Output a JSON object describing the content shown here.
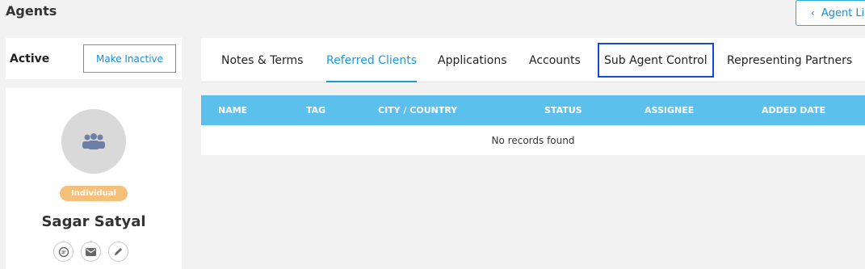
{
  "header": {
    "title": "Agents",
    "agent_list_label": "Agent List"
  },
  "status": {
    "label": "Active",
    "toggle_label": "Make Inactive"
  },
  "profile": {
    "type_badge": "Individual",
    "name": "Sagar Satyal",
    "actions": [
      "chat-icon",
      "mail-icon",
      "edit-icon"
    ]
  },
  "tabs": [
    {
      "label": "Notes & Terms"
    },
    {
      "label": "Referred Clients",
      "active": true
    },
    {
      "label": "Applications"
    },
    {
      "label": "Accounts"
    },
    {
      "label": "Sub Agent Control",
      "highlighted": true
    },
    {
      "label": "Representing Partners"
    }
  ],
  "table": {
    "columns": [
      "NAME",
      "TAG",
      "CITY / COUNTRY",
      "STATUS",
      "ASSIGNEE",
      "ADDED DATE"
    ],
    "empty_message": "No records found"
  },
  "colors": {
    "accent": "#1a9be0",
    "table_header": "#5bc0ec",
    "badge": "#f6bf7a",
    "highlight_border": "#1649d6"
  }
}
